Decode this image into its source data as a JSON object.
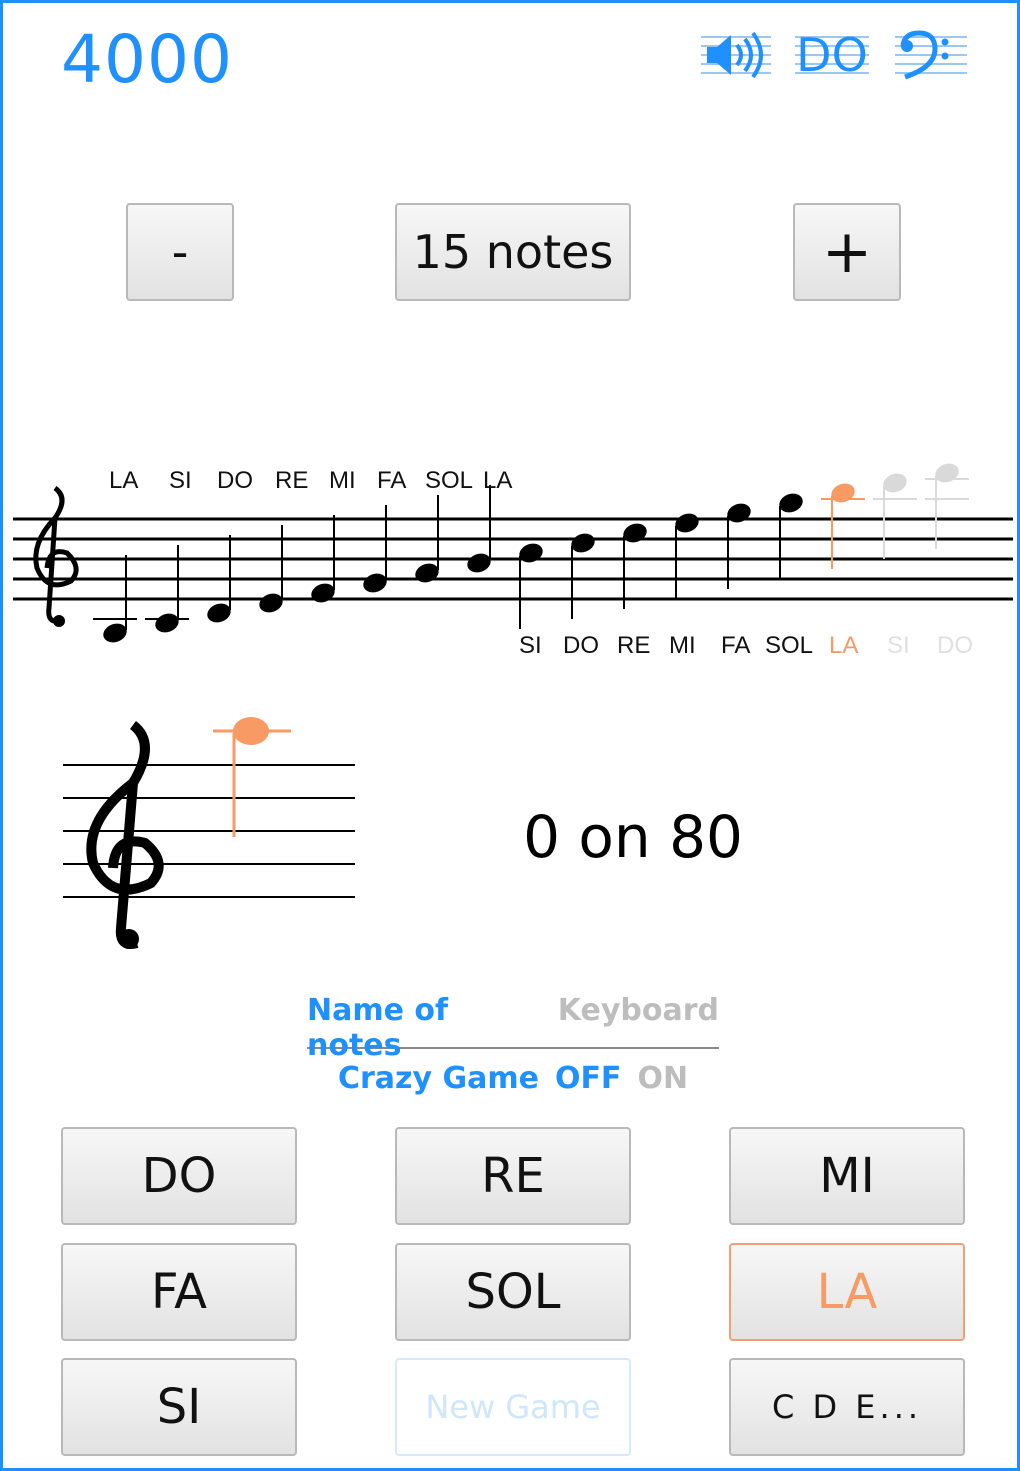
{
  "header": {
    "score": "4000",
    "sound_icon": "speaker-icon",
    "solfege_label": "DO",
    "clef_icon": "bass-clef-icon"
  },
  "controls": {
    "minus_label": "-",
    "notes_count_label": "15 notes",
    "plus_label": "+"
  },
  "range_staff": {
    "upper_labels": [
      "LA",
      "SI",
      "DO",
      "RE",
      "MI",
      "FA",
      "SOL",
      "LA"
    ],
    "lower_labels": [
      "SI",
      "DO",
      "RE",
      "MI",
      "FA",
      "SOL",
      "LA",
      "SI",
      "DO"
    ],
    "highlight_color": "#f79a64",
    "inactive_color": "#d9d9d9"
  },
  "quiz": {
    "progress_text": "0 on 80",
    "current_note_color": "#f79a64"
  },
  "modes": {
    "name_of_notes": "Name of notes",
    "keyboard": "Keyboard",
    "crazy_game": "Crazy Game",
    "off": "OFF",
    "on": "ON"
  },
  "answers": {
    "do": "DO",
    "re": "RE",
    "mi": "MI",
    "fa": "FA",
    "sol": "SOL",
    "la": "LA",
    "si": "SI",
    "new_game": "New Game",
    "cde": "C D E..."
  }
}
